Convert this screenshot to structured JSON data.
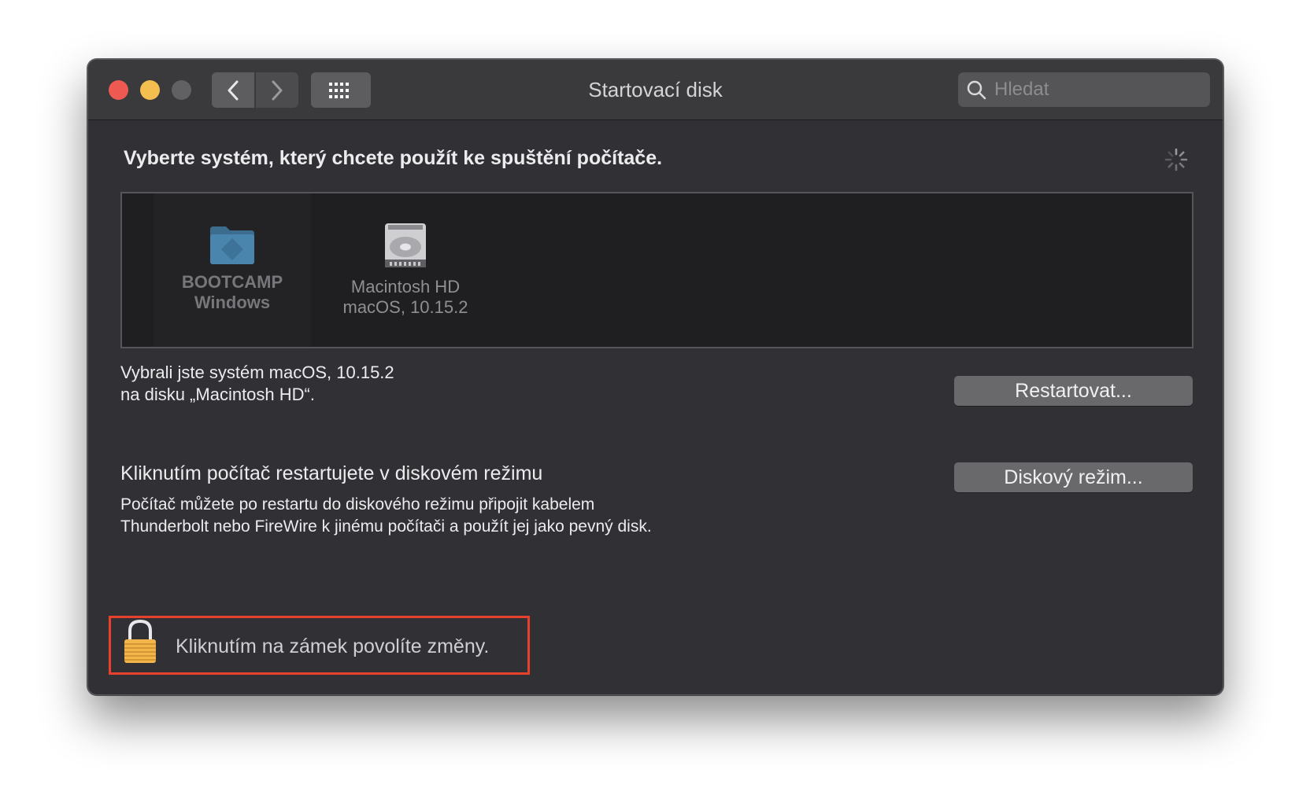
{
  "window": {
    "title": "Startovací disk"
  },
  "search": {
    "placeholder": "Hledat",
    "value": ""
  },
  "main": {
    "heading": "Vyberte systém, který chcete použít ke spuštění počítače.",
    "disks": [
      {
        "name": "BOOTCAMP",
        "sub": "Windows",
        "icon": "bootcamp-folder-icon"
      },
      {
        "name": "Macintosh HD",
        "sub": "macOS, 10.15.2",
        "icon": "hard-drive-icon"
      }
    ],
    "selected_line1": "Vybrali jste systém macOS, 10.15.2",
    "selected_line2": "na disku „Macintosh HD“.",
    "restart_label": "Restartovat...",
    "diskmode_title": "Kliknutím počítač restartujete v diskovém režimu",
    "diskmode_desc1": "Počítač můžete po restartu do diskového režimu připojit kabelem",
    "diskmode_desc2": "Thunderbolt nebo FireWire k jinému počítači a použít jej jako pevný disk.",
    "diskmode_button": "Diskový režim..."
  },
  "footer": {
    "lock_text": "Kliknutím na zámek povolíte změny."
  },
  "colors": {
    "window_bg": "#313135",
    "titlebar_bg": "#3a3a3d",
    "close": "#ee5a52",
    "minimize": "#f4bf4f",
    "highlight_border": "#e8402a",
    "lock_gold": "#f2b54a"
  }
}
